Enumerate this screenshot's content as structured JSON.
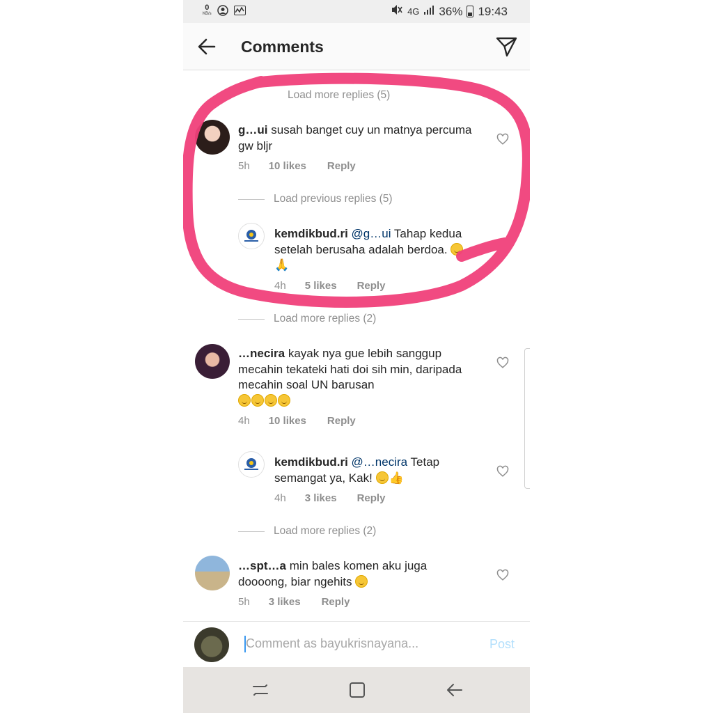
{
  "status_bar": {
    "data_speed": "0",
    "data_unit": "KB/s",
    "network": "4G",
    "battery": "36%",
    "time": "19:43"
  },
  "header": {
    "title": "Comments"
  },
  "comments": [
    {
      "top_load": "Load more replies (5)",
      "username": "g…ui",
      "text": "susah banget cuy un matnya percuma gw bljr",
      "time": "5h",
      "likes": "10 likes",
      "reply": "Reply",
      "load_previous": "Load previous replies (5)"
    },
    {
      "username": "kemdikbud.ri",
      "mention": "@g…ui",
      "text": "Tahap kedua setelah berusaha adalah berdoa.",
      "time": "4h",
      "likes": "5 likes",
      "reply": "Reply",
      "load_more": "Load more replies (2)"
    },
    {
      "username": "…necira",
      "text": "kayak nya gue lebih sanggup mecahin tekateki hati doi sih min, daripada mecahin soal UN barusan",
      "time": "4h",
      "likes": "10 likes",
      "reply": "Reply"
    },
    {
      "username": "kemdikbud.ri",
      "mention": "@…necira",
      "text": "Tetap semangat ya, Kak!",
      "time": "4h",
      "likes": "3 likes",
      "reply": "Reply",
      "load_more": "Load more replies (2)"
    },
    {
      "username": "…spt…a",
      "text": "min bales komen aku juga doooong, biar ngehits",
      "time": "5h",
      "likes": "3 likes",
      "reply": "Reply"
    }
  ],
  "compose": {
    "placeholder": "Comment as bayukrisnayana...",
    "post_label": "Post"
  },
  "colors": {
    "highlight_ring": "#f0407a",
    "post_disabled": "#b2dffc",
    "meta_gray": "#8e8e8e"
  },
  "icons": [
    "back-arrow-icon",
    "send-direct-icon",
    "heart-icon",
    "recent-apps-icon",
    "home-icon",
    "back-nav-icon"
  ]
}
